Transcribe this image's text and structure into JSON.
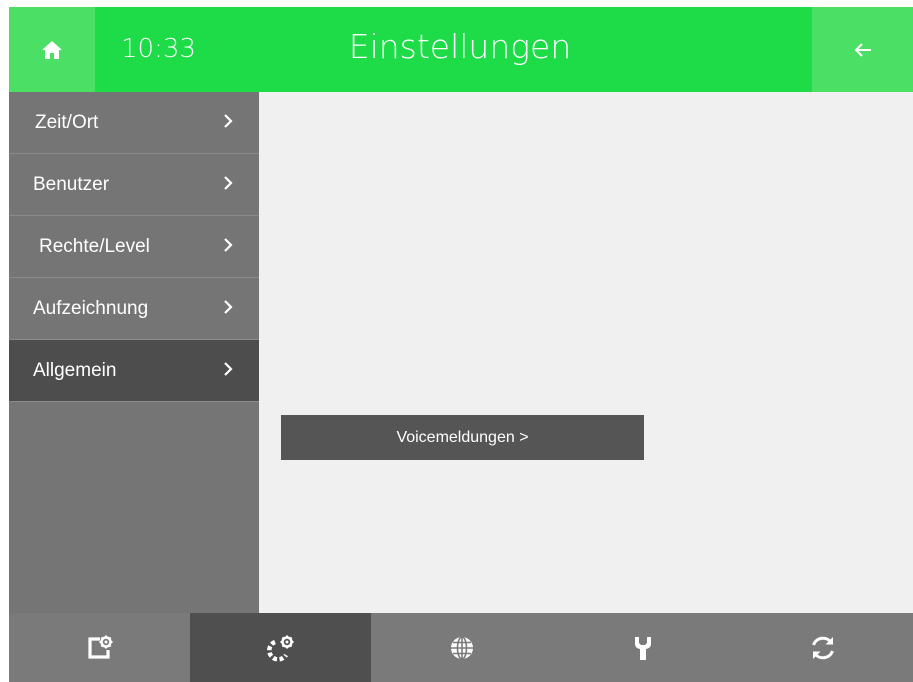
{
  "header": {
    "time": "10:33",
    "title": "Einstellungen",
    "home_icon": "home-icon",
    "back_icon": "arrow-left-icon"
  },
  "sidebar": {
    "items": [
      {
        "label": "Zeit/Ort",
        "active": false
      },
      {
        "label": "Benutzer",
        "active": false
      },
      {
        "label": "Rechte/Level",
        "active": false
      },
      {
        "label": "Aufzeichnung",
        "active": false
      },
      {
        "label": "Allgemein",
        "active": true
      }
    ]
  },
  "content": {
    "voice_button_label": "Voicemeldungen >"
  },
  "footer": {
    "icons": [
      "device-settings-icon",
      "settings-gears-icon",
      "globe-icon",
      "wrench-icon",
      "refresh-icon"
    ],
    "active_index": 1
  },
  "colors": {
    "header_green": "#1ddc47",
    "header_button_green": "#4bdf66",
    "sidebar_gray": "#757575",
    "sidebar_active": "#4d4d4d",
    "content_bg": "#f0f0f0",
    "footer_gray": "#7a7a7a",
    "footer_active": "#4f4f4f"
  }
}
